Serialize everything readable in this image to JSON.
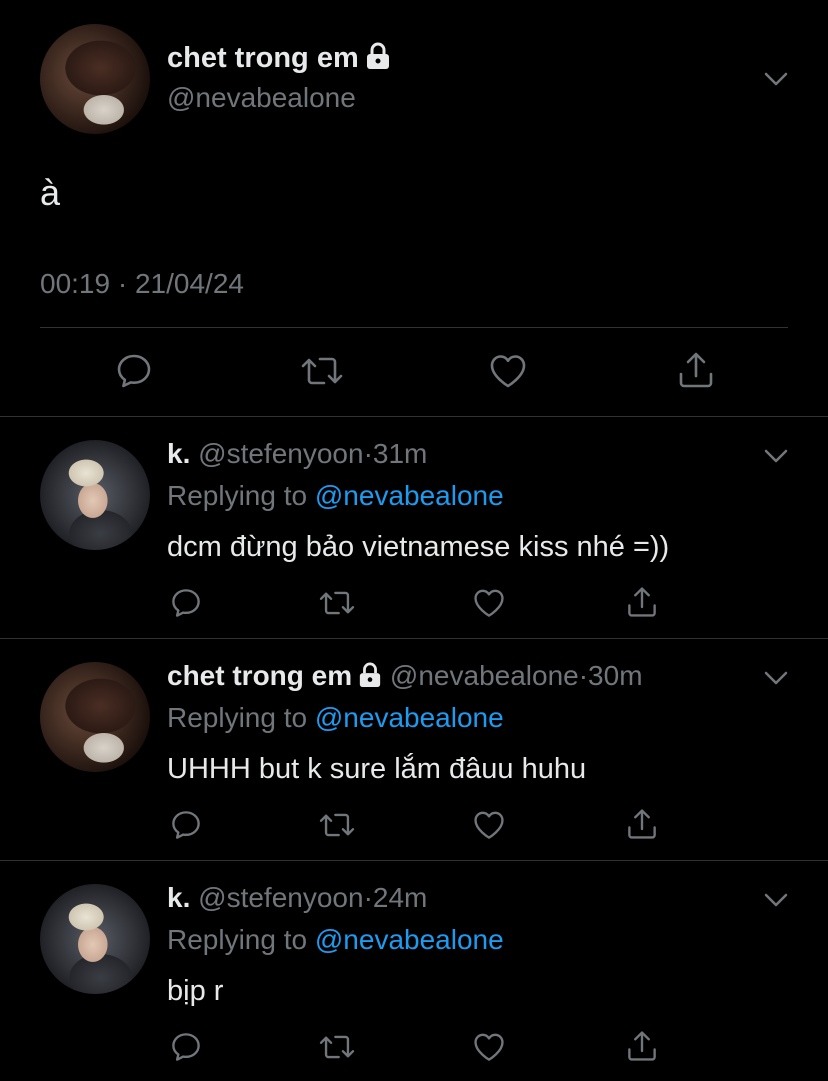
{
  "main_tweet": {
    "display_name": "chet trong em",
    "handle": "@nevabealone",
    "text": "à",
    "time": "00:19",
    "separator": "·",
    "date": "21/04/24"
  },
  "replies": [
    {
      "display_name": "k.",
      "handle": "@stefenyoon",
      "separator": "·",
      "age": "31m",
      "replying_prefix": "Replying to",
      "replying_to": "@nevabealone",
      "text": "dcm đừng bảo vietnamese kiss nhé =))"
    },
    {
      "display_name": "chet trong em",
      "handle": "@nevabealone",
      "separator": "·",
      "age": "30m",
      "replying_prefix": "Replying to",
      "replying_to": "@nevabealone",
      "text": "UHHH but k sure lắm đâuu huhu"
    },
    {
      "display_name": "k.",
      "handle": "@stefenyoon",
      "separator": "·",
      "age": "24m",
      "replying_prefix": "Replying to",
      "replying_to": "@nevabealone",
      "text": "bịp r"
    }
  ],
  "icons": [
    "chevron-down-icon",
    "lock-icon",
    "reply-icon",
    "retweet-icon",
    "like-icon",
    "share-icon"
  ],
  "colors": {
    "background": "#000000",
    "text": "#e7e9ea",
    "muted": "#71767b",
    "link": "#1d9bf0",
    "divider": "#2f3336"
  }
}
